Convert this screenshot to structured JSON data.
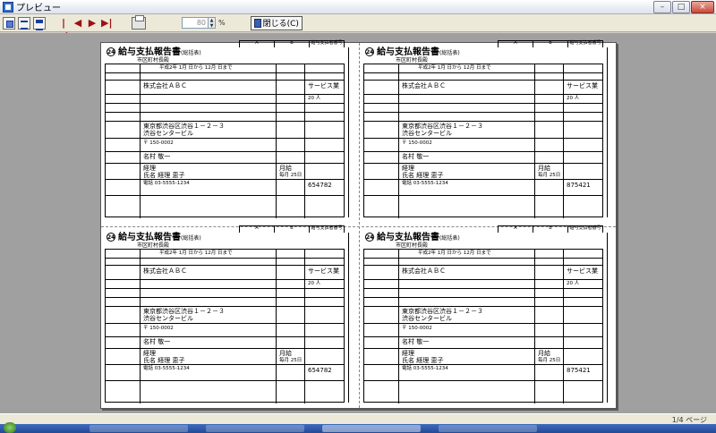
{
  "window": {
    "title": "プレビュー"
  },
  "toolbar": {
    "zoom_value": "80",
    "zoom_unit": "%",
    "close_label": "閉じる(C)"
  },
  "status": {
    "page_info": "1/4 ページ"
  },
  "form": {
    "number": "24",
    "title": "給与支払報告書",
    "subtitle": "(総括表)",
    "destination": "市区町村長殿",
    "period": "平成2年 1月 日から 12月 日まで",
    "company": "株式会社ＡＢＣ",
    "business": "サービス業",
    "address": "東京都渋谷区渋谷１－２－３",
    "building": "渋谷センタービル",
    "postal": "〒 150-0002",
    "rep_name": "名村 敬一",
    "dept": "経理",
    "contact_name": "氏名 経理 恵子",
    "phone": "電話 03-5555-1234",
    "pay_date": "月給",
    "pay_day": "毎月 25日",
    "designated_no": "654782",
    "designated_no_alt": "875421",
    "employees": "20 人",
    "head_A": "A",
    "head_B": "B",
    "head_C": "給与支払者番号"
  }
}
